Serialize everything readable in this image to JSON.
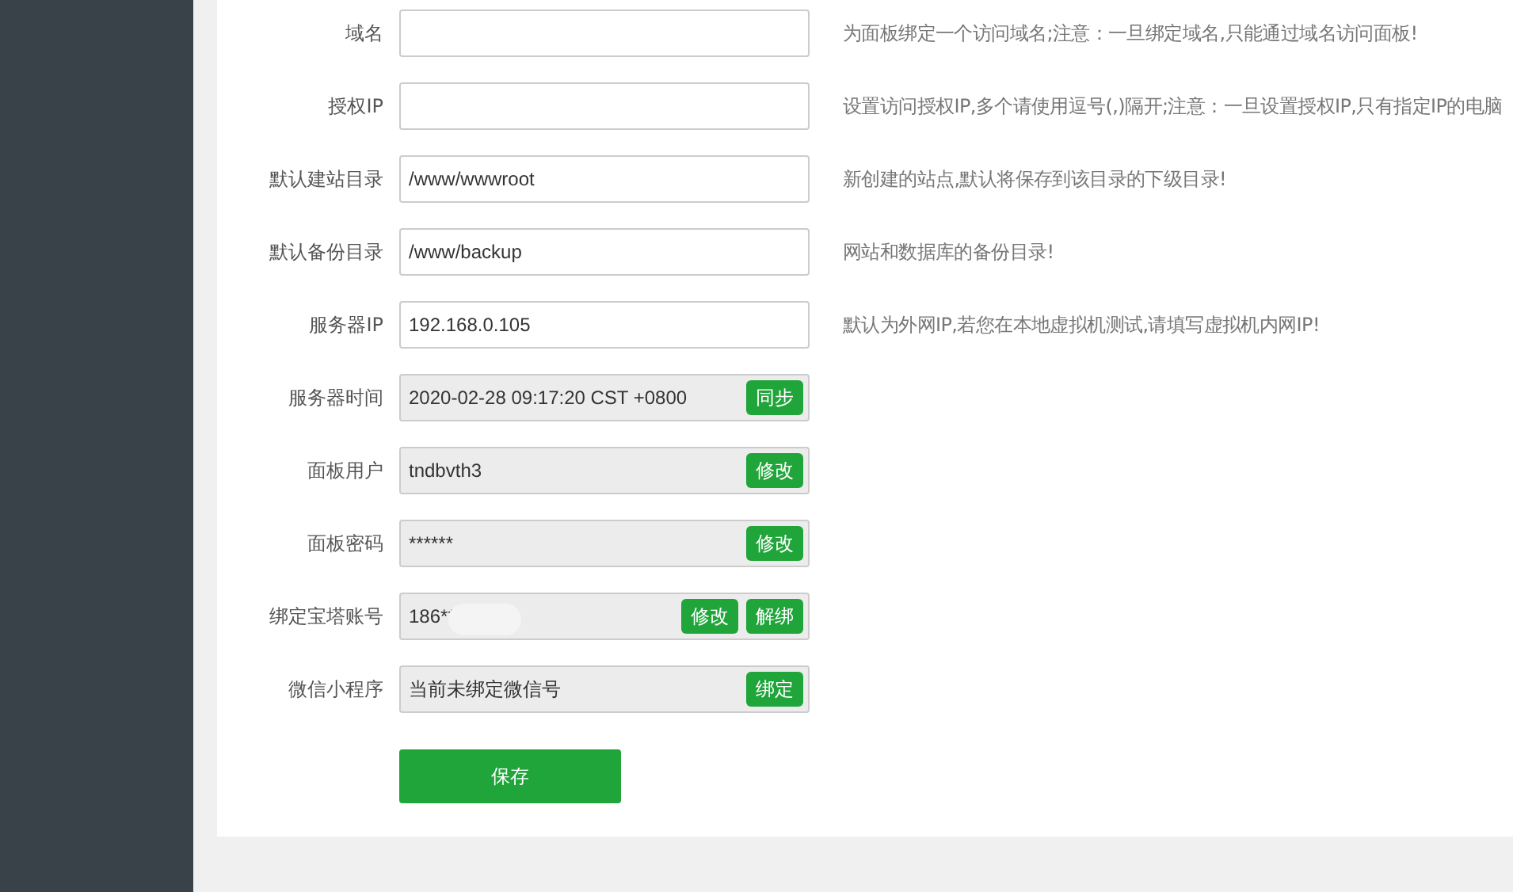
{
  "settings": [
    {
      "kind": "input",
      "label": "域名",
      "hint": "为面板绑定一个访问域名;注意：一旦绑定域名,只能通过域名访问面板!"
    },
    {
      "kind": "input",
      "label": "授权IP",
      "hint": "设置访问授权IP,多个请使用逗号(,)隔开;注意：一旦设置授权IP,只有指定IP的电脑"
    },
    {
      "kind": "input",
      "label": "默认建站目录",
      "value": "/www/wwwroot",
      "hint": "新创建的站点,默认将保存到该目录的下级目录!"
    },
    {
      "kind": "input",
      "label": "默认备份目录",
      "value": "/www/backup",
      "hint": "网站和数据库的备份目录!"
    },
    {
      "kind": "input",
      "label": "服务器IP",
      "value": "192.168.0.105",
      "hint": "默认为外网IP,若您在本地虚拟机测试,请填写虚拟机内网IP!"
    },
    {
      "kind": "readonly",
      "label": "服务器时间",
      "value": "2020-02-28 09:17:20 CST +0800",
      "buttons": [
        "同步"
      ]
    },
    {
      "kind": "readonly",
      "label": "面板用户",
      "value": "tndbvth3",
      "buttons": [
        "修改"
      ]
    },
    {
      "kind": "readonly",
      "label": "面板密码",
      "value": "******",
      "buttons": [
        "修改"
      ]
    },
    {
      "kind": "readonly",
      "label": "绑定宝塔账号",
      "value": "186**",
      "buttons": [
        "修改",
        "解绑"
      ],
      "redacted": true
    },
    {
      "kind": "readonly",
      "label": "微信小程序",
      "value": "当前未绑定微信号",
      "buttons": [
        "绑定"
      ]
    }
  ],
  "save_button": "保存"
}
